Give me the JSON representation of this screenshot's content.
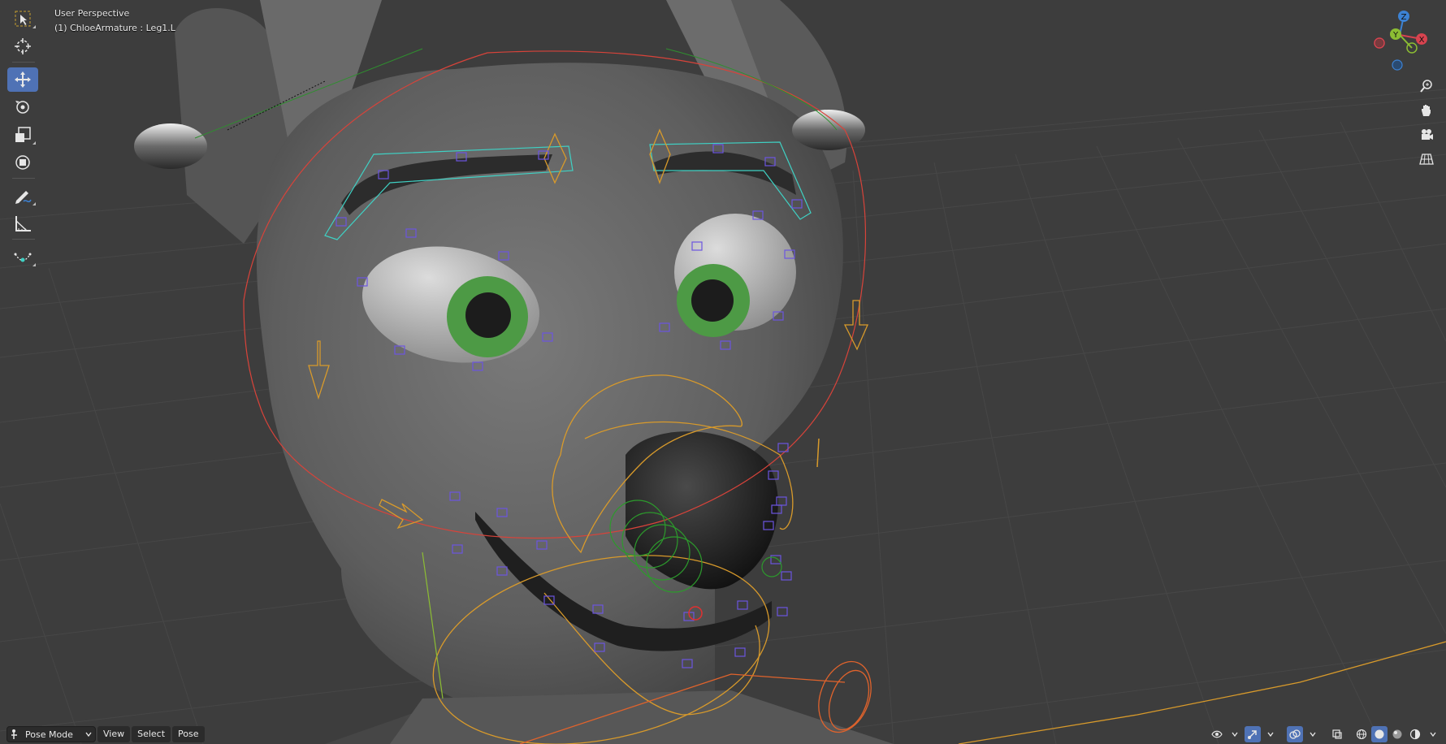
{
  "viewport": {
    "perspective_label": "User Perspective",
    "object_info": "(1) ChloeArmature : Leg1.L"
  },
  "toolbar": {
    "tools": [
      {
        "name": "select-box-icon",
        "active": false
      },
      {
        "name": "cursor-icon",
        "active": false
      },
      {
        "name": "move-icon",
        "active": true
      },
      {
        "name": "rotate-icon",
        "active": false
      },
      {
        "name": "scale-icon",
        "active": false
      },
      {
        "name": "transform-icon",
        "active": false
      },
      {
        "name": "annotate-icon",
        "active": false
      },
      {
        "name": "measure-icon",
        "active": false
      },
      {
        "name": "bone-bend-icon",
        "active": false
      }
    ]
  },
  "gizmo": {
    "x_label": "X",
    "y_label": "Y",
    "z_label": "Z",
    "colors": {
      "x": "#d8434f",
      "y": "#8cbd33",
      "z": "#3c82d4"
    }
  },
  "header": {
    "mode": "Pose Mode",
    "menus": [
      "View",
      "Select",
      "Pose"
    ]
  },
  "colors": {
    "viewport_bg": "#3d3d3d",
    "grid": "#4a4a4a",
    "active_tool": "#4f72b5"
  }
}
